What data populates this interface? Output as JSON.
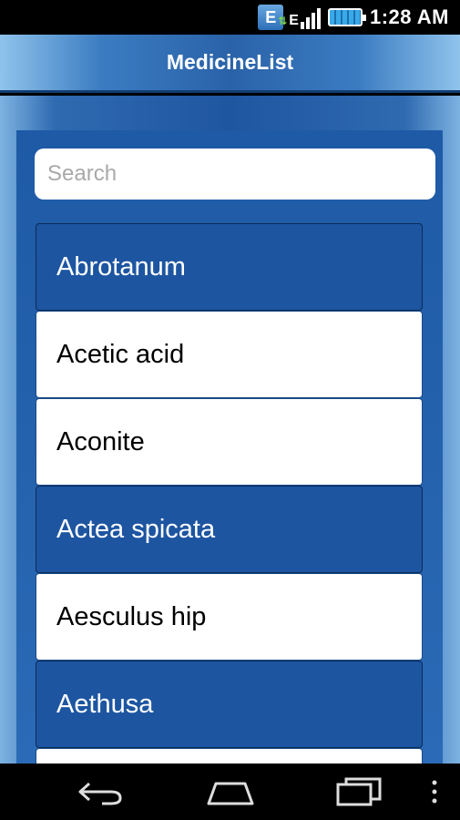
{
  "status_bar": {
    "time": "1:28 AM",
    "network_label": "E",
    "notification_icon_letter": "E"
  },
  "header": {
    "title": "MedicineList"
  },
  "search": {
    "placeholder": "Search",
    "value": ""
  },
  "list": {
    "items": [
      {
        "label": "Abrotanum",
        "style": "highlight"
      },
      {
        "label": "Acetic acid",
        "style": "plain"
      },
      {
        "label": "Aconite",
        "style": "plain"
      },
      {
        "label": "Actea spicata",
        "style": "highlight"
      },
      {
        "label": "Aesculus hip",
        "style": "plain"
      },
      {
        "label": "Aethusa",
        "style": "highlight"
      },
      {
        "label": "",
        "style": "plain"
      }
    ]
  },
  "colors": {
    "accent_blue": "#1d55a1",
    "header_blue": "#2a62a8",
    "item_white": "#ffffff"
  },
  "icons": {
    "status": [
      "notification-e-icon",
      "signal-icon",
      "battery-icon"
    ],
    "nav": [
      "back-icon",
      "home-icon",
      "recent-apps-icon",
      "overflow-menu-icon"
    ]
  }
}
